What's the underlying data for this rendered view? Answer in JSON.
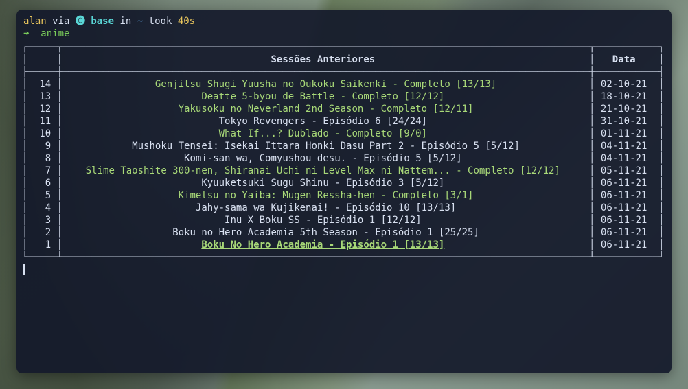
{
  "prompt": {
    "user": "alan",
    "via": "via",
    "env_symbol": "🅒",
    "env": "base",
    "in": "in",
    "path": "~",
    "took": "took",
    "duration": "40s",
    "arrow": "➜",
    "command": "anime"
  },
  "table": {
    "headers": {
      "sessoes": "Sessões Anteriores",
      "data": "Data"
    },
    "rows": [
      {
        "idx": "14",
        "title": "Genjitsu Shugi Yuusha no Oukoku Saikenki - Completo [13/13]",
        "date": "02-10-21",
        "status": "completo",
        "selected": false
      },
      {
        "idx": "13",
        "title": "Deatte 5-byou de Battle - Completo [12/12]",
        "date": "18-10-21",
        "status": "completo",
        "selected": false
      },
      {
        "idx": "12",
        "title": "Yakusoku no Neverland 2nd Season - Completo [12/11]",
        "date": "21-10-21",
        "status": "completo",
        "selected": false
      },
      {
        "idx": "11",
        "title": "Tokyo Revengers - Episódio 6 [24/24]",
        "date": "31-10-21",
        "status": "episodio",
        "selected": false
      },
      {
        "idx": "10",
        "title": "What If...? Dublado - Completo [9/0]",
        "date": "01-11-21",
        "status": "completo",
        "selected": false
      },
      {
        "idx": "9",
        "title": "Mushoku Tensei: Isekai Ittara Honki Dasu Part 2 - Episódio 5 [5/12]",
        "date": "04-11-21",
        "status": "episodio",
        "selected": false
      },
      {
        "idx": "8",
        "title": "Komi-san wa, Comyushou desu. - Episódio 5 [5/12]",
        "date": "04-11-21",
        "status": "episodio",
        "selected": false
      },
      {
        "idx": "7",
        "title": "Slime Taoshite 300-nen, Shiranai Uchi ni Level Max ni Nattem... - Completo [12/12]",
        "date": "05-11-21",
        "status": "completo",
        "selected": false
      },
      {
        "idx": "6",
        "title": "Kyuuketsuki Sugu Shinu - Episódio 3 [5/12]",
        "date": "06-11-21",
        "status": "episodio",
        "selected": false
      },
      {
        "idx": "5",
        "title": "Kimetsu no Yaiba: Mugen Ressha-hen - Completo [3/1]",
        "date": "06-11-21",
        "status": "completo",
        "selected": false
      },
      {
        "idx": "4",
        "title": "Jahy-sama wa Kujikenai! - Episódio 10 [13/13]",
        "date": "06-11-21",
        "status": "episodio",
        "selected": false
      },
      {
        "idx": "3",
        "title": "Inu X Boku SS - Episódio 1 [12/12]",
        "date": "06-11-21",
        "status": "episodio",
        "selected": false
      },
      {
        "idx": "2",
        "title": "Boku no Hero Academia 5th Season - Episódio 1 [25/25]",
        "date": "06-11-21",
        "status": "episodio",
        "selected": false
      },
      {
        "idx": "1",
        "title": "Boku No Hero Academia - Episódio 1 [13/13]",
        "date": "06-11-21",
        "status": "completo",
        "selected": true
      }
    ]
  }
}
